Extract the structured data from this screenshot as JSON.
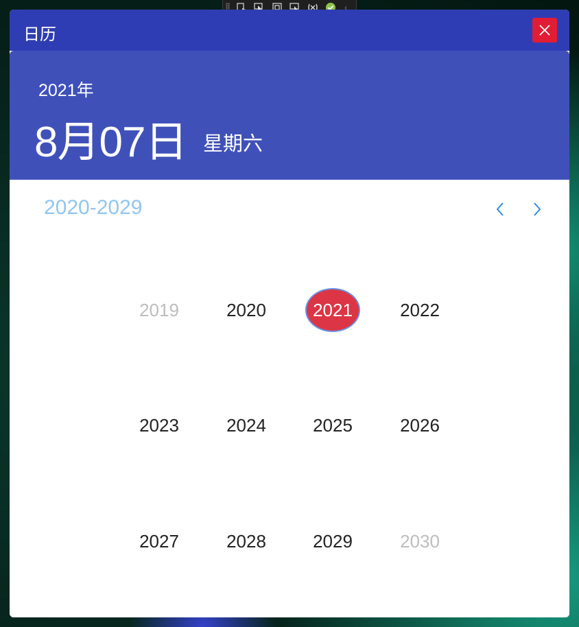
{
  "window": {
    "title": "日历"
  },
  "header": {
    "year": "2021年",
    "date": "8月07日",
    "weekday": "星期六"
  },
  "picker": {
    "decade": "2020-2029",
    "years": [
      {
        "label": "2019",
        "state": "out-of-range"
      },
      {
        "label": "2020",
        "state": "normal"
      },
      {
        "label": "2021",
        "state": "selected"
      },
      {
        "label": "2022",
        "state": "normal"
      },
      {
        "label": "2023",
        "state": "normal"
      },
      {
        "label": "2024",
        "state": "normal"
      },
      {
        "label": "2025",
        "state": "normal"
      },
      {
        "label": "2026",
        "state": "normal"
      },
      {
        "label": "2027",
        "state": "normal"
      },
      {
        "label": "2028",
        "state": "normal"
      },
      {
        "label": "2029",
        "state": "normal"
      },
      {
        "label": "2030",
        "state": "out-of-range"
      }
    ]
  },
  "devtools": {
    "icons": [
      "select-element-icon",
      "cursor-icon",
      "layout-adorner-icon",
      "track-focus-icon",
      "binding-failures-icon",
      "check-icon",
      "collapse-chevron-icon"
    ]
  },
  "colors": {
    "titlebar": "#2f3db4",
    "header": "#3f51b9",
    "close": "#e11d35",
    "selected": "#dc3545",
    "decade": "#90c6f0",
    "nav": "#2b8fe0"
  }
}
